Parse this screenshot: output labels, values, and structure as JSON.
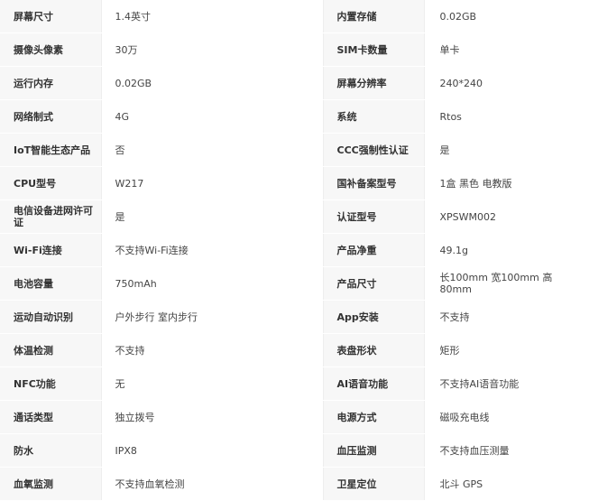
{
  "specs": {
    "rows": [
      {
        "left_label": "屏幕尺寸",
        "left_value": "1.4英寸",
        "right_label": "内置存储",
        "right_value": "0.02GB"
      },
      {
        "left_label": "摄像头像素",
        "left_value": "30万",
        "right_label": "SIM卡数量",
        "right_value": "单卡"
      },
      {
        "left_label": "运行内存",
        "left_value": "0.02GB",
        "right_label": "屏幕分辨率",
        "right_value": "240*240"
      },
      {
        "left_label": "网络制式",
        "left_value": "4G",
        "right_label": "系统",
        "right_value": "Rtos"
      },
      {
        "left_label": "IoT智能生态产品",
        "left_value": "否",
        "right_label": "CCC强制性认证",
        "right_value": "是"
      },
      {
        "left_label": "CPU型号",
        "left_value": "W217",
        "right_label": "国补备案型号",
        "right_value": "1盒 黑色 电教版"
      },
      {
        "left_label": "电信设备进网许可证",
        "left_value": "是",
        "right_label": "认证型号",
        "right_value": "XPSWM002"
      },
      {
        "left_label": "Wi-Fi连接",
        "left_value": "不支持Wi-Fi连接",
        "right_label": "产品净重",
        "right_value": "49.1g"
      },
      {
        "left_label": "电池容量",
        "left_value": "750mAh",
        "right_label": "产品尺寸",
        "right_value": "长100mm 宽100mm 高80mm"
      },
      {
        "left_label": "运动自动识别",
        "left_value": "户外步行 室内步行",
        "right_label": "App安装",
        "right_value": "不支持"
      },
      {
        "left_label": "体温检测",
        "left_value": "不支持",
        "right_label": "表盘形状",
        "right_value": "矩形"
      },
      {
        "left_label": "NFC功能",
        "left_value": "无",
        "right_label": "AI语音功能",
        "right_value": "不支持AI语音功能"
      },
      {
        "left_label": "通话类型",
        "left_value": "独立拨号",
        "right_label": "电源方式",
        "right_value": "磁吸充电线"
      },
      {
        "left_label": "防水",
        "left_value": "IPX8",
        "right_label": "血压监测",
        "right_value": "不支持血压测量"
      },
      {
        "left_label": "血氧监测",
        "left_value": "不支持血氧检测",
        "right_label": "卫星定位",
        "right_value": "北斗 GPS"
      }
    ]
  }
}
